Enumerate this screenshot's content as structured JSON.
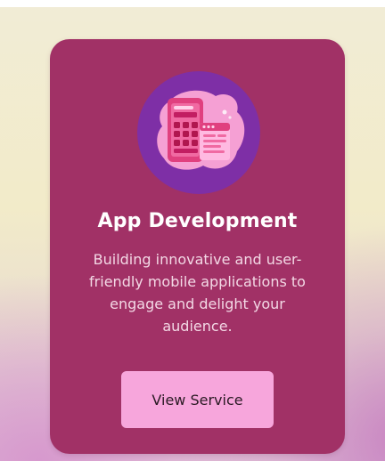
{
  "card": {
    "icon": "mobile-app-development-icon",
    "title": "App Development",
    "description": "Building innovative and user-friendly mobile applications to engage and delight your audience.",
    "button_label": "View Service"
  },
  "colors": {
    "card_background": "#a13166",
    "icon_circle": "#7e2fa6",
    "button_background": "#f7a6dc",
    "title_text": "#ffffff",
    "description_text": "#f3d8e5"
  }
}
